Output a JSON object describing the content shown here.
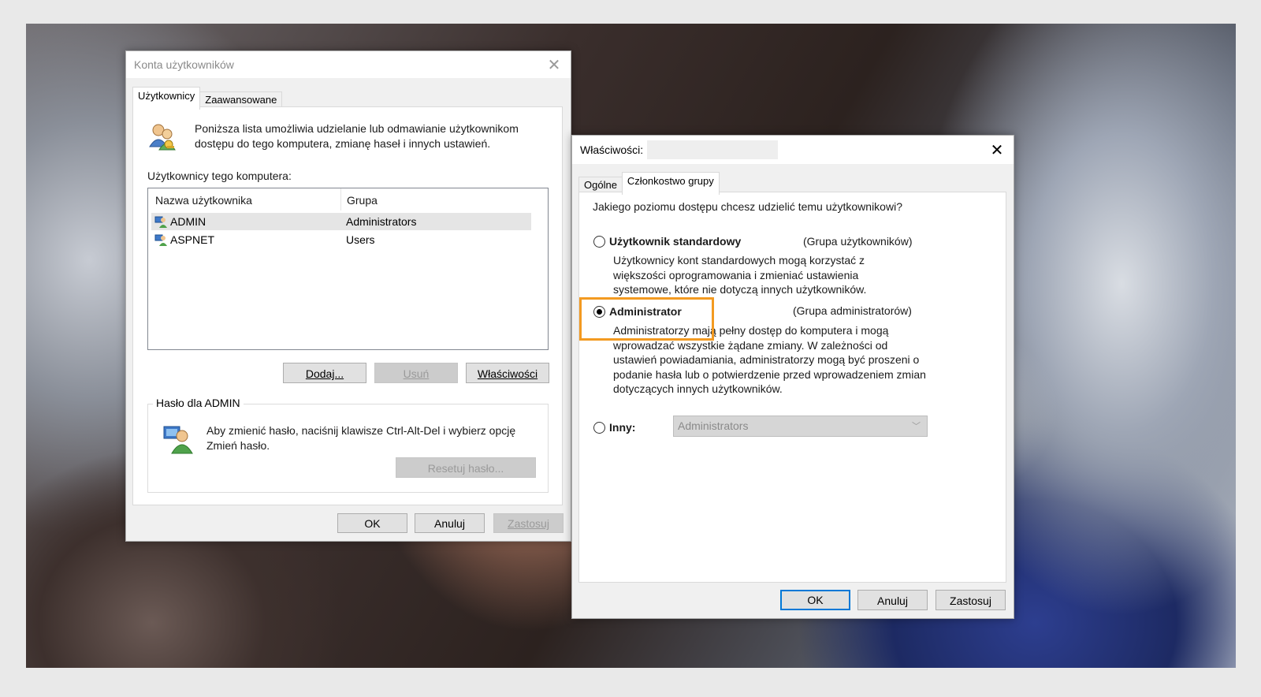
{
  "window1": {
    "title": "Konta użytkowników",
    "tabs": [
      "Użytkownicy",
      "Zaawansowane"
    ],
    "intro": "Poniższa lista umożliwia udzielanie lub odmawianie użytkownikom dostępu do tego komputera, zmianę haseł i innych ustawień.",
    "list_label": "Użytkownicy tego komputera:",
    "columns": [
      "Nazwa użytkownika",
      "Grupa"
    ],
    "users": [
      {
        "name": "ADMIN",
        "group": "Administrators"
      },
      {
        "name": "ASPNET",
        "group": "Users"
      }
    ],
    "buttons": {
      "add": "Dodaj...",
      "remove": "Usuń",
      "properties": "Właściwości"
    },
    "password_group": "Hasło dla ADMIN",
    "password_text": "Aby zmienić hasło, naciśnij klawisze Ctrl-Alt-Del i wybierz opcję Zmień hasło.",
    "reset_button": "Resetuj hasło...",
    "footer": {
      "ok": "OK",
      "cancel": "Anuluj",
      "apply": "Zastosuj"
    }
  },
  "window2": {
    "title": "Właściwości:",
    "tabs": [
      "Ogólne",
      "Członkostwo grupy"
    ],
    "question": "Jakiego poziomu dostępu chcesz udzielić temu użytkownikowi?",
    "option_standard": {
      "label": "Użytkownik standardowy",
      "group": "(Grupa użytkowników)",
      "desc": "Użytkownicy kont standardowych mogą korzystać z większości oprogramowania i zmieniać ustawienia systemowe, które nie dotyczą innych użytkowników.",
      "selected": false
    },
    "option_admin": {
      "label": "Administrator",
      "group": "(Grupa administratorów)",
      "desc": "Administratorzy mają pełny dostęp do komputera i mogą wprowadzać wszystkie żądane zmiany. W zależności od ustawień powiadamiania, administratorzy mogą być proszeni o podanie hasła lub o potwierdzenie przed wprowadzeniem zmian dotyczących innych użytkowników.",
      "selected": true
    },
    "option_other": {
      "label": "Inny:",
      "value": "Administrators",
      "selected": false
    },
    "footer": {
      "ok": "OK",
      "cancel": "Anuluj",
      "apply": "Zastosuj"
    }
  },
  "colors": {
    "highlight": "#f39a21",
    "focus": "#0078d7"
  }
}
